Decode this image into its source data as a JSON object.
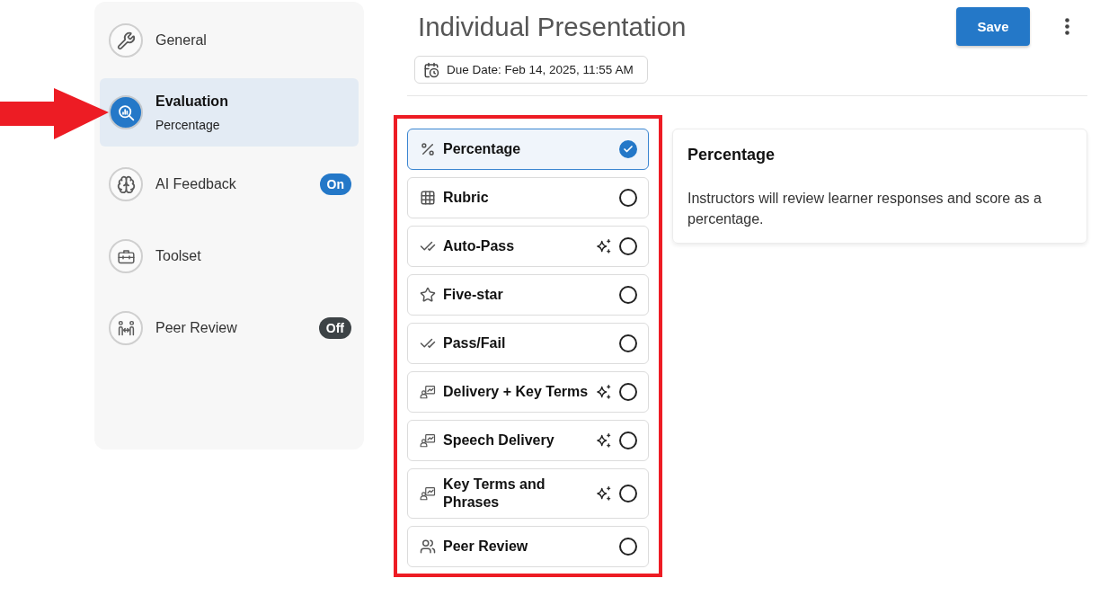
{
  "sidebar": {
    "items": [
      {
        "label": "General",
        "selected": false
      },
      {
        "label": "Evaluation",
        "subtitle": "Percentage",
        "selected": true
      },
      {
        "label": "AI Feedback",
        "selected": false,
        "badge": {
          "text": "On",
          "on": true
        }
      },
      {
        "label": "Toolset",
        "selected": false
      },
      {
        "label": "Peer Review",
        "selected": false,
        "badge": {
          "text": "Off",
          "on": false
        }
      }
    ]
  },
  "header": {
    "title": "Individual Presentation",
    "due_date": "Due Date: Feb 14, 2025, 11:55 AM",
    "save_button": "Save"
  },
  "evaluation_types": [
    {
      "label": "Percentage",
      "selected": true,
      "ai_powered": false
    },
    {
      "label": "Rubric",
      "selected": false,
      "ai_powered": false
    },
    {
      "label": "Auto-Pass",
      "selected": false,
      "ai_powered": true
    },
    {
      "label": "Five-star",
      "selected": false,
      "ai_powered": false
    },
    {
      "label": "Pass/Fail",
      "selected": false,
      "ai_powered": false
    },
    {
      "label": "Delivery + Key Terms",
      "selected": false,
      "ai_powered": true
    },
    {
      "label": "Speech Delivery",
      "selected": false,
      "ai_powered": true
    },
    {
      "label": "Key Terms and Phrases",
      "selected": false,
      "ai_powered": true
    },
    {
      "label": "Peer Review",
      "selected": false,
      "ai_powered": false
    }
  ],
  "detail": {
    "title": "Percentage",
    "description": "Instructors will review learner responses and score as a percentage."
  }
}
